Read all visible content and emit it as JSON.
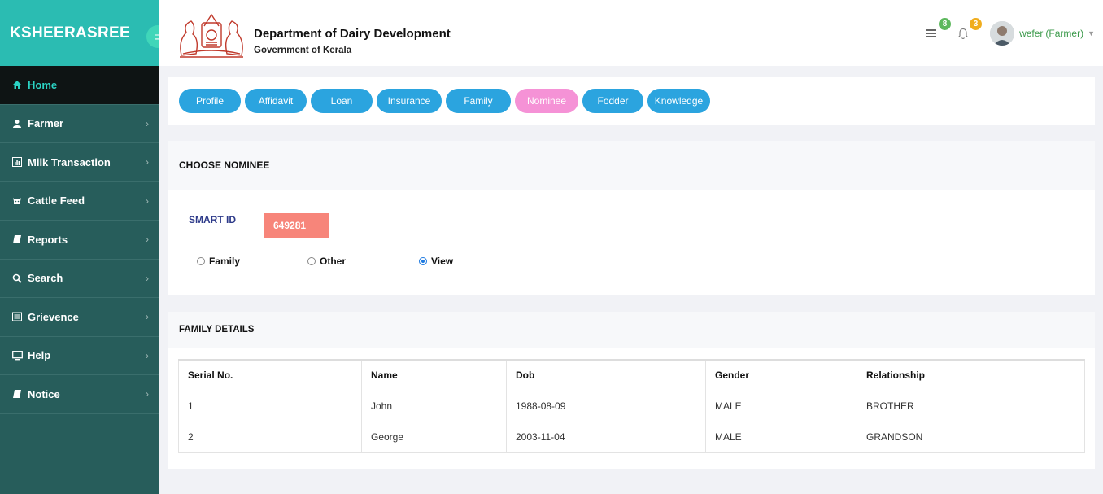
{
  "brand": {
    "name": "KSHEERASREE"
  },
  "header": {
    "title": "Department of Dairy Development",
    "subtitle": "Government of Kerala",
    "messages_badge": "8",
    "notifications_badge": "3",
    "user_name": "wefer",
    "user_role": "(Farmer)"
  },
  "sidebar": {
    "items": [
      {
        "label": "Home",
        "icon": "home-icon"
      },
      {
        "label": "Farmer",
        "icon": "user-icon"
      },
      {
        "label": "Milk Transaction",
        "icon": "bar-chart-icon"
      },
      {
        "label": "Cattle Feed",
        "icon": "cattle-icon"
      },
      {
        "label": "Reports",
        "icon": "book-icon"
      },
      {
        "label": "Search",
        "icon": "search-icon"
      },
      {
        "label": "Grievence",
        "icon": "list-icon"
      },
      {
        "label": "Help",
        "icon": "monitor-icon"
      },
      {
        "label": "Notice",
        "icon": "book-icon"
      }
    ]
  },
  "tabs": [
    "Profile",
    "Affidavit",
    "Loan",
    "Insurance",
    "Family",
    "Nominee",
    "Fodder",
    "Knowledge"
  ],
  "choose": {
    "heading": "CHOOSE NOMINEE",
    "smart_id_label": "SMART ID",
    "smart_id_value": "649281",
    "radio_family": "Family",
    "radio_other": "Other",
    "radio_view": "View"
  },
  "family": {
    "heading": "FAMILY DETAILS",
    "columns": [
      "Serial No.",
      "Name",
      "Dob",
      "Gender",
      "Relationship"
    ],
    "rows": [
      [
        "1",
        "John",
        "1988-08-09",
        "MALE",
        "BROTHER"
      ],
      [
        "2",
        "George",
        "2003-11-04",
        "MALE",
        "GRANDSON"
      ]
    ]
  },
  "colors": {
    "brand": "#2bbcb2",
    "sidebar": "#275d5b",
    "tab": "#2ba4df",
    "tab_active": "#f592d6",
    "smart_id_bg": "#f7857a"
  }
}
